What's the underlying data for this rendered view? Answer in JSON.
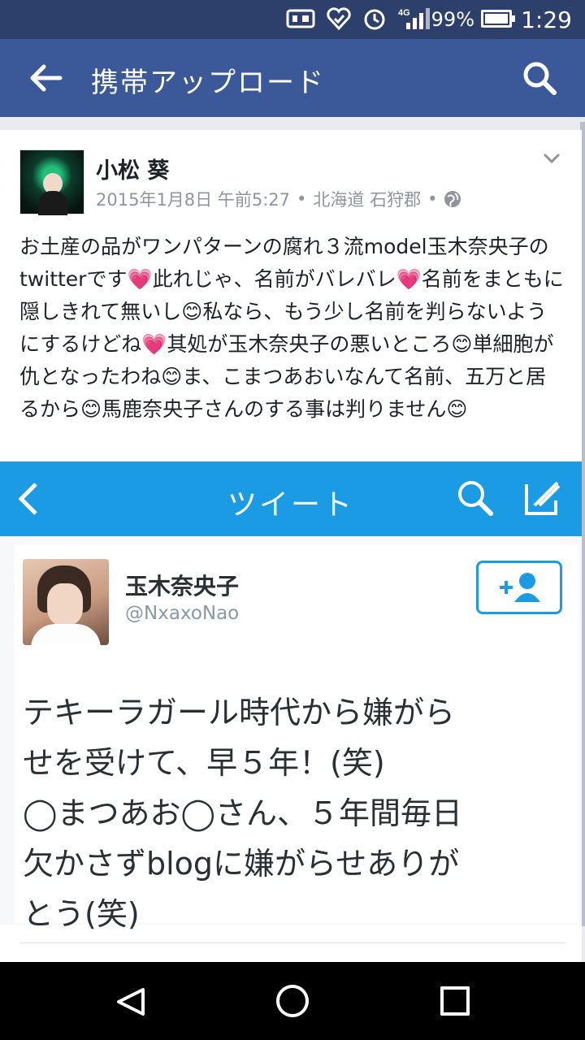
{
  "status_bar": {
    "network": "4G",
    "battery": "99%",
    "battery_level": 0.99,
    "time": "1:29",
    "icons": [
      "signal-icon",
      "notification-icon",
      "heart-icon",
      "alarm-icon",
      "network-4g-icon",
      "battery-icon"
    ]
  },
  "app_bar": {
    "title": "携帯アップロード",
    "back_icon": "arrow-left-icon",
    "search_icon": "search-icon"
  },
  "post": {
    "author": "小松 葵",
    "timestamp": "2015年1月8日 午前5:27",
    "location": "北海道 石狩郡",
    "separator": "•",
    "privacy_icon": "globe-icon",
    "menu_icon": "chevron-down-icon",
    "text": "お土産の品がワンパターンの腐れ３流model玉木奈央子のtwitterです💗此れじゃ、名前がバレバレ💗名前をまともに隠しきれて無いし😊私なら、もう少し名前を判らないようにするけどね💗其処が玉木奈央子の悪いところ😊単細胞が仇となったわね😊ま、こまつあおいなんて名前、五万と居るから😊馬鹿奈央子さんのする事は判りません😊"
  },
  "embedded_screenshot": {
    "nav_title": "ツイート",
    "back_icon": "chevron-left-icon",
    "search_icon": "search-icon",
    "compose_icon": "compose-icon",
    "name": "玉木奈央子",
    "handle": "@NxaxoNao",
    "follow_icon": "add-user-icon",
    "tweet_lines": [
      "テキーラガール時代から嫌がら",
      "せを受けて、早５年！(笑)",
      "◯まつあお◯さん、５年間毎日",
      "欠かさずblogに嫌がらせありが",
      "とう(笑)"
    ]
  },
  "nav_bar": {
    "back_icon": "triangle-back-icon",
    "home_icon": "circle-home-icon",
    "recents_icon": "square-recents-icon"
  },
  "colors": {
    "facebook_blue": "#3b5998",
    "status_bar": "#2d3f6b",
    "twitter_blue": "#1c9be5"
  }
}
